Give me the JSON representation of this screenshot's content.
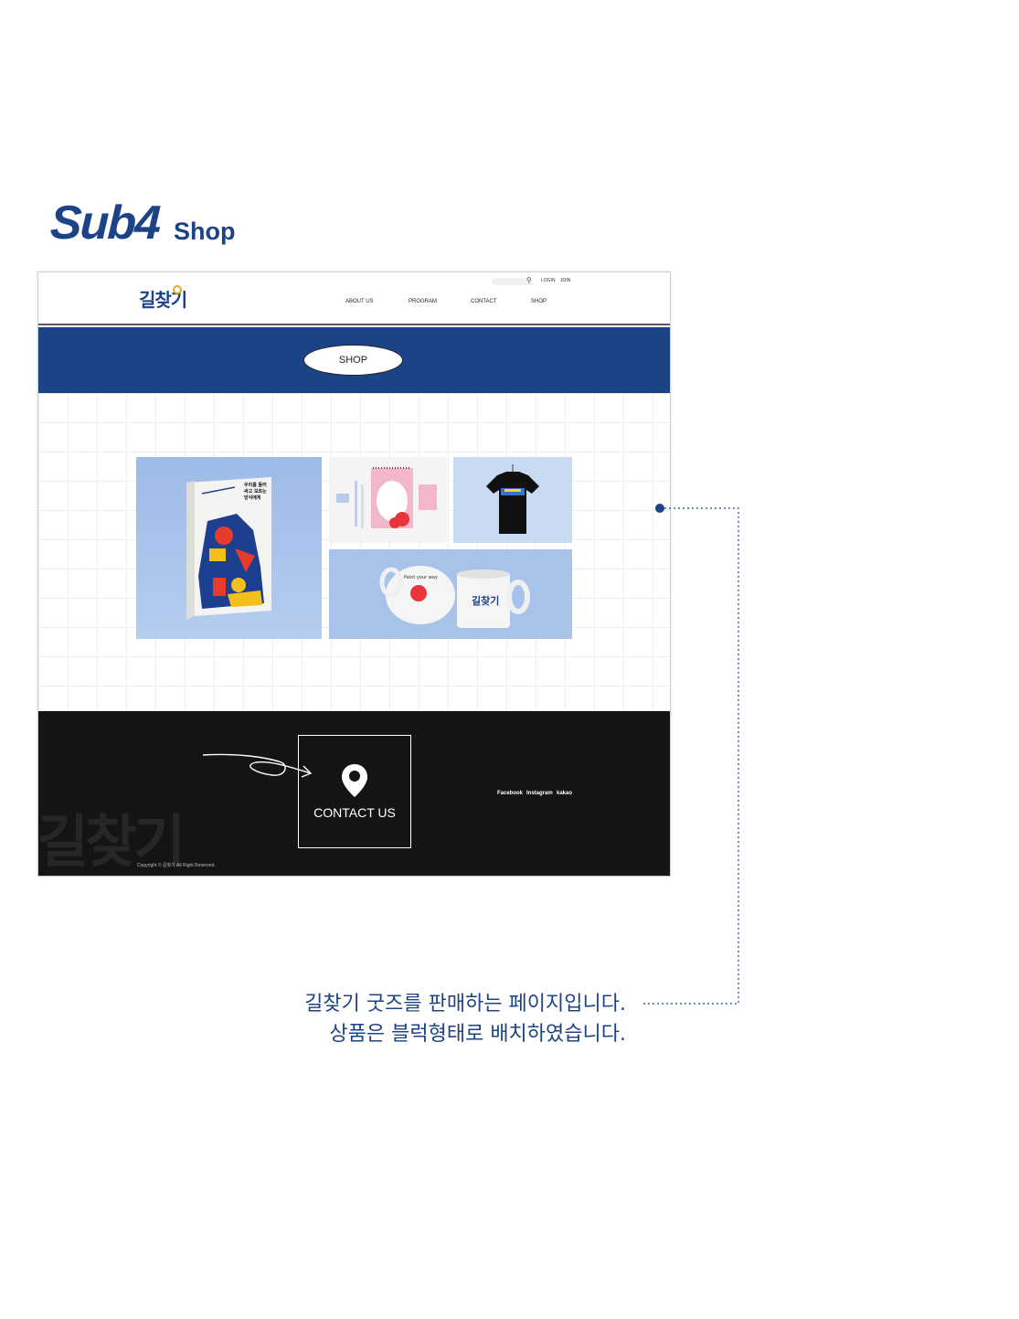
{
  "heading": {
    "main": "Sub4",
    "sub": "Shop"
  },
  "site": {
    "logo_text": "길찾기",
    "top_links": {
      "login": "LOGIN",
      "join": "JOIN"
    },
    "nav": [
      "ABOUT US",
      "PROGRAM",
      "CONTACT",
      "SHOP"
    ],
    "banner_label": "SHOP",
    "products": [
      {
        "name": "book",
        "cover_text": "우리를 둘러싸고 모르는 방식에게"
      },
      {
        "name": "stationery"
      },
      {
        "name": "t-shirt"
      },
      {
        "name": "mugs",
        "mug_text": "Paint your way"
      }
    ],
    "footer": {
      "contact_label": "CONTACT US",
      "social": [
        "Facebook",
        "Instagram",
        "kakao"
      ],
      "copyright": "Copyright © 길찾기 All Right Reserved.",
      "watermark": "길찾기"
    }
  },
  "annotation": {
    "line1": "길찾기 굿즈를 판매하는 페이지입니다.",
    "line2": "상품은 블럭형태로 배치하였습니다."
  },
  "colors": {
    "brand": "#1c4385",
    "banner": "#1a4486",
    "footer": "#141414",
    "accent": "#e2a91c"
  }
}
